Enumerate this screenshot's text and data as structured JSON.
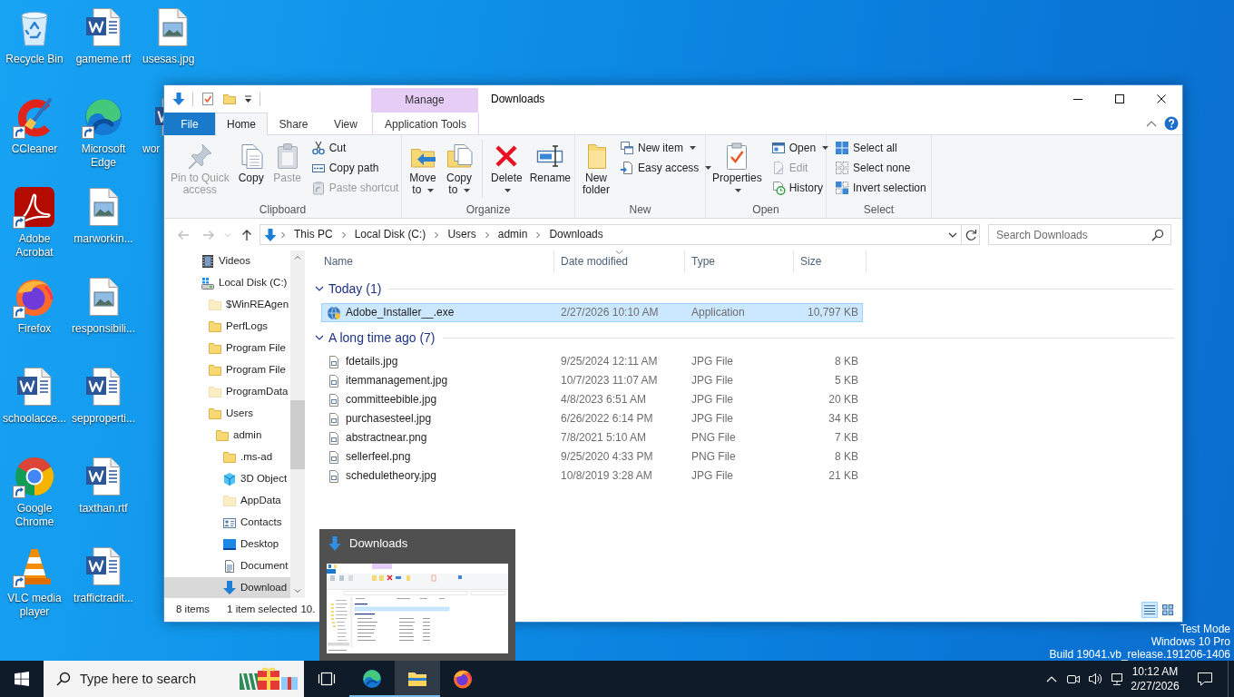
{
  "desktop": {
    "icons": [
      {
        "label": "Recycle Bin",
        "kind": "bin",
        "shortcut": false
      },
      {
        "label": "CCleaner",
        "kind": "app",
        "shortcut": true
      },
      {
        "label": "Adobe Acrobat",
        "kind": "app",
        "shortcut": true
      },
      {
        "label": "Firefox",
        "kind": "app",
        "shortcut": true
      },
      {
        "label": "schoolacce...",
        "kind": "document",
        "shortcut": false
      },
      {
        "label": "Google Chrome",
        "kind": "app",
        "shortcut": true
      },
      {
        "label": "VLC media player",
        "kind": "app",
        "shortcut": true
      },
      {
        "label": "gameme.rtf",
        "kind": "document",
        "shortcut": false
      },
      {
        "label": "Microsoft Edge",
        "kind": "app",
        "shortcut": true
      },
      {
        "label": "marworkin...",
        "kind": "image",
        "shortcut": false
      },
      {
        "label": "responsibili...",
        "kind": "image",
        "shortcut": false
      },
      {
        "label": "sepproperti...",
        "kind": "document",
        "shortcut": false
      },
      {
        "label": "taxthan.rtf",
        "kind": "document",
        "shortcut": false
      },
      {
        "label": "traffictradit...",
        "kind": "document",
        "shortcut": false
      },
      {
        "label": "usesas.jpg",
        "kind": "image",
        "shortcut": false
      },
      {
        "label": "wor",
        "kind": "document",
        "shortcut": false
      }
    ]
  },
  "explorer": {
    "title": "Downloads",
    "contextual_group": "Manage",
    "tabs": [
      {
        "label": "File",
        "kind": "file",
        "selected": false
      },
      {
        "label": "Home",
        "kind": "tab",
        "selected": true
      },
      {
        "label": "Share",
        "kind": "tab",
        "selected": false
      },
      {
        "label": "View",
        "kind": "tab",
        "selected": false
      },
      {
        "label": "Application Tools",
        "kind": "contextual",
        "selected": false
      }
    ],
    "ribbon": {
      "groups": [
        {
          "label": "Clipboard",
          "items": [
            {
              "kind": "large",
              "label": "Pin to Quick\naccess",
              "disabled": true,
              "dropdown": false
            },
            {
              "kind": "large",
              "label": "Copy",
              "disabled": false,
              "dropdown": false
            },
            {
              "kind": "large",
              "label": "Paste",
              "disabled": true,
              "dropdown": false
            },
            {
              "kind": "small",
              "label": "Cut",
              "disabled": false,
              "dropdown": false
            },
            {
              "kind": "small",
              "label": "Copy path",
              "disabled": false,
              "dropdown": false
            },
            {
              "kind": "small",
              "label": "Paste shortcut",
              "disabled": true,
              "dropdown": false
            }
          ]
        },
        {
          "label": "Organize",
          "items": [
            {
              "kind": "large",
              "label": "Move\nto",
              "disabled": false,
              "dropdown": true
            },
            {
              "kind": "large",
              "label": "Copy\nto",
              "disabled": false,
              "dropdown": true
            },
            {
              "kind": "separator"
            },
            {
              "kind": "large",
              "label": "Delete",
              "disabled": false,
              "dropdown": true
            },
            {
              "kind": "large",
              "label": "Rename",
              "disabled": false,
              "dropdown": false
            }
          ]
        },
        {
          "label": "New",
          "items": [
            {
              "kind": "large",
              "label": "New\nfolder",
              "disabled": false,
              "dropdown": false
            },
            {
              "kind": "small",
              "label": "New item",
              "disabled": false,
              "dropdown": true
            },
            {
              "kind": "small",
              "label": "Easy access",
              "disabled": false,
              "dropdown": true
            }
          ]
        },
        {
          "label": "Open",
          "items": [
            {
              "kind": "large",
              "label": "Properties",
              "disabled": false,
              "dropdown": true
            },
            {
              "kind": "small",
              "label": "Open",
              "disabled": false,
              "dropdown": true
            },
            {
              "kind": "small",
              "label": "Edit",
              "disabled": true,
              "dropdown": false
            },
            {
              "kind": "small",
              "label": "History",
              "disabled": false,
              "dropdown": false
            }
          ]
        },
        {
          "label": "Select",
          "items": [
            {
              "kind": "small",
              "label": "Select all",
              "disabled": false,
              "dropdown": false
            },
            {
              "kind": "small",
              "label": "Select none",
              "disabled": false,
              "dropdown": false
            },
            {
              "kind": "small",
              "label": "Invert selection",
              "disabled": false,
              "dropdown": false
            }
          ]
        }
      ]
    },
    "address": {
      "nav_buttons": [
        {
          "kind": "back",
          "disabled": true
        },
        {
          "kind": "forward",
          "disabled": true
        },
        {
          "kind": "recent",
          "disabled": true
        },
        {
          "kind": "up",
          "disabled": false
        }
      ],
      "breadcrumbs": [
        "This PC",
        "Local Disk (C:)",
        "Users",
        "admin",
        "Downloads"
      ]
    },
    "search": {
      "placeholder": "Search Downloads"
    },
    "nav_pane": {
      "items": [
        {
          "label": "Videos",
          "kind": "videos",
          "hidden": false,
          "selected": false
        },
        {
          "label": "Local Disk (C:)",
          "kind": "drive",
          "hidden": false,
          "selected": false,
          "children": [
            {
              "label": "$WinREAgen",
              "kind": "folder",
              "hidden": true,
              "selected": false
            },
            {
              "label": "PerfLogs",
              "kind": "folder",
              "hidden": false,
              "selected": false
            },
            {
              "label": "Program File",
              "kind": "folder",
              "hidden": false,
              "selected": false
            },
            {
              "label": "Program File",
              "kind": "folder",
              "hidden": false,
              "selected": false
            },
            {
              "label": "ProgramData",
              "kind": "folder",
              "hidden": true,
              "selected": false
            },
            {
              "label": "Users",
              "kind": "folder",
              "hidden": false,
              "selected": false,
              "children": [
                {
                  "label": "admin",
                  "kind": "folder",
                  "hidden": false,
                  "selected": false,
                  "children": [
                    {
                      "label": ".ms-ad",
                      "kind": "folder",
                      "hidden": false,
                      "selected": false
                    },
                    {
                      "label": "3D Object",
                      "kind": "objects",
                      "hidden": false,
                      "selected": false
                    },
                    {
                      "label": "AppData",
                      "kind": "folder",
                      "hidden": true,
                      "selected": false
                    },
                    {
                      "label": "Contacts",
                      "kind": "contacts",
                      "hidden": false,
                      "selected": false
                    },
                    {
                      "label": "Desktop",
                      "kind": "desktop",
                      "hidden": false,
                      "selected": false
                    },
                    {
                      "label": "Document",
                      "kind": "documents",
                      "hidden": false,
                      "selected": false
                    },
                    {
                      "label": "Download",
                      "kind": "downloads",
                      "hidden": false,
                      "selected": true
                    }
                  ]
                }
              ]
            }
          ]
        }
      ]
    },
    "file_list": {
      "columns": [
        {
          "label": "Name",
          "sorted": false
        },
        {
          "label": "Date modified",
          "sorted": true
        },
        {
          "label": "Type",
          "sorted": false
        },
        {
          "label": "Size",
          "sorted": false
        }
      ],
      "groups": [
        {
          "label": "Today (1)",
          "expanded": true,
          "rows": [
            {
              "kind": "application",
              "name": "Adobe_Installer__.exe",
              "date": "2/27/2026 10:10 AM",
              "type": "Application",
              "size": "10,797 KB",
              "selected": true
            }
          ]
        },
        {
          "label": "A long time ago (7)",
          "expanded": true,
          "rows": [
            {
              "kind": "image",
              "name": "fdetails.jpg",
              "date": "9/25/2024 12:11 AM",
              "type": "JPG File",
              "size": "8 KB",
              "selected": false
            },
            {
              "kind": "image",
              "name": "itemmanagement.jpg",
              "date": "10/7/2023 11:07 AM",
              "type": "JPG File",
              "size": "5 KB",
              "selected": false
            },
            {
              "kind": "image",
              "name": "committeebible.jpg",
              "date": "4/8/2023 6:51 AM",
              "type": "JPG File",
              "size": "20 KB",
              "selected": false
            },
            {
              "kind": "image",
              "name": "purchasesteel.jpg",
              "date": "6/26/2022 6:14 PM",
              "type": "JPG File",
              "size": "34 KB",
              "selected": false
            },
            {
              "kind": "image",
              "name": "abstractnear.png",
              "date": "7/8/2021 5:10 AM",
              "type": "PNG File",
              "size": "7 KB",
              "selected": false
            },
            {
              "kind": "image",
              "name": "sellerfeel.png",
              "date": "9/25/2020 4:33 PM",
              "type": "PNG File",
              "size": "8 KB",
              "selected": false
            },
            {
              "kind": "image",
              "name": "scheduletheory.jpg",
              "date": "10/8/2019 3:28 AM",
              "type": "JPG File",
              "size": "21 KB",
              "selected": false
            }
          ]
        }
      ]
    },
    "status_bar": {
      "item_count": "8 items",
      "selection": "1 item selected",
      "selection_size": "10.",
      "views": [
        {
          "kind": "details",
          "selected": true
        },
        {
          "kind": "large-icons",
          "selected": false
        }
      ]
    }
  },
  "thumbnail_preview": {
    "title": "Downloads"
  },
  "system_watermark": [
    "Test Mode",
    "Windows 10 Pro",
    "Build 19041.vb_release.191206-1406"
  ],
  "taskbar": {
    "search": {
      "placeholder": "Type here to search"
    },
    "apps": [
      {
        "running": true,
        "active": false
      },
      {
        "running": true,
        "active": true
      },
      {
        "running": false,
        "active": false
      }
    ],
    "clock": {
      "time": "10:12 AM",
      "date": "2/27/2026"
    }
  }
}
